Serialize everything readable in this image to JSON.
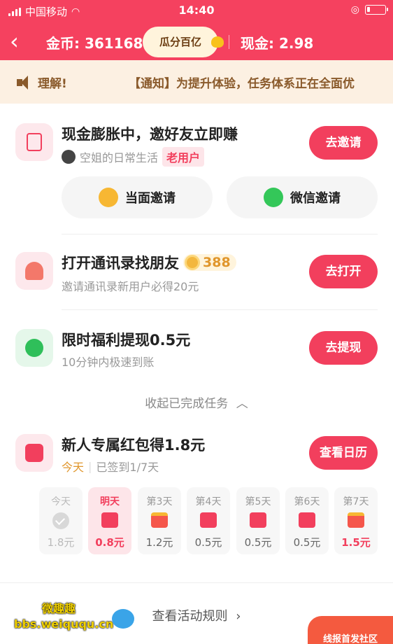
{
  "status_bar": {
    "carrier": "中国移动",
    "time": "14:40"
  },
  "navbar": {
    "coins_label": "金币: 361168",
    "pill_label": "瓜分百亿",
    "cash_label": "现金: 2.98"
  },
  "notice": {
    "prefix": "理解!",
    "message": "【通知】为提升体验，任务体系正在全面优"
  },
  "invite_task": {
    "title": "现金膨胀中，邀好友立即赚",
    "user_name": "空姐的日常生活",
    "user_tag": "老用户",
    "button": "去邀请",
    "face_invite": "当面邀请",
    "wechat_invite": "微信邀请"
  },
  "contacts_task": {
    "title": "打开通讯录找朋友",
    "coin_amount": "388",
    "subtitle": "邀请通讯录新用户必得20元",
    "button": "去打开"
  },
  "withdraw_task": {
    "title": "限时福利提现0.5元",
    "subtitle": "10分钟内极速到账",
    "button": "去提现"
  },
  "collapse_label": "收起已完成任务",
  "redpacket_task": {
    "title": "新人专属红包得1.8元",
    "today": "今天",
    "signed": "已签到1/7天",
    "button": "查看日历"
  },
  "days": [
    {
      "label": "今天",
      "value": "1.8元",
      "state": "done"
    },
    {
      "label": "明天",
      "value": "0.8元",
      "state": "active"
    },
    {
      "label": "第3天",
      "value": "1.2元",
      "state": "gift"
    },
    {
      "label": "第4天",
      "value": "0.5元",
      "state": "packet"
    },
    {
      "label": "第5天",
      "value": "0.5元",
      "state": "packet"
    },
    {
      "label": "第6天",
      "value": "0.5元",
      "state": "packet"
    },
    {
      "label": "第7天",
      "value": "1.5元",
      "state": "gift-big"
    }
  ],
  "footer": {
    "rules_link": "查看活动规则",
    "watermark_title": "微趣趣",
    "watermark_url": "bbs.weiququ.cn",
    "corner_label": "线报首发社区"
  },
  "colors": {
    "brand_red": "#f5415f",
    "button_red": "#f23f5d",
    "notice_bg": "#fcf0e2",
    "coin_gold": "#f3b73e"
  }
}
